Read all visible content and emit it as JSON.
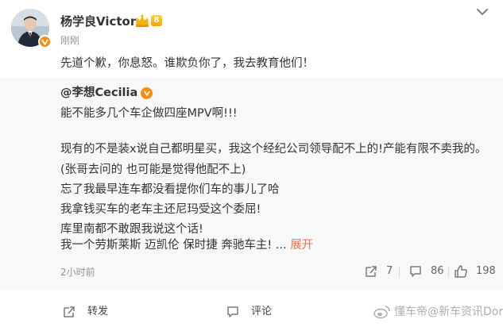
{
  "post": {
    "author": "杨学良Victor",
    "member_rank": "8",
    "time": "刚刚",
    "text": "先道个歉，你息怒。谁欺负你了，我去教育他们！"
  },
  "repost": {
    "author": "@李想Cecilia",
    "lines": [
      "能不能多几个车企做四座MPV啊!!!",
      "现有的不是装x说自己都明星买，我这个经纪公司领导配不上的!产能有限不卖我的。",
      "(张哥去问的 也可能是觉得他配不上)",
      "忘了我最早连车都没看提你们车的事儿了哈",
      "我拿钱买车的老车主还尼玛受这个委屈!",
      "库里南都不敢跟我说这个话!",
      "我一个劳斯莱斯 迈凯伦 保时捷 奔驰车主! ..."
    ],
    "expand_label": "展开",
    "time": "2小时前",
    "stats": {
      "reposts": "7",
      "comments": "86",
      "likes": "198"
    }
  },
  "actions": {
    "repost_label": "转发",
    "comment_label": "评论"
  },
  "watermark": "懂车帝@新车资讯Dora",
  "colors": {
    "accent_orange": "#eb7350",
    "verify_orange": "#f78c12",
    "gray_text": "#939393",
    "repost_bg": "#f8f8f8"
  }
}
